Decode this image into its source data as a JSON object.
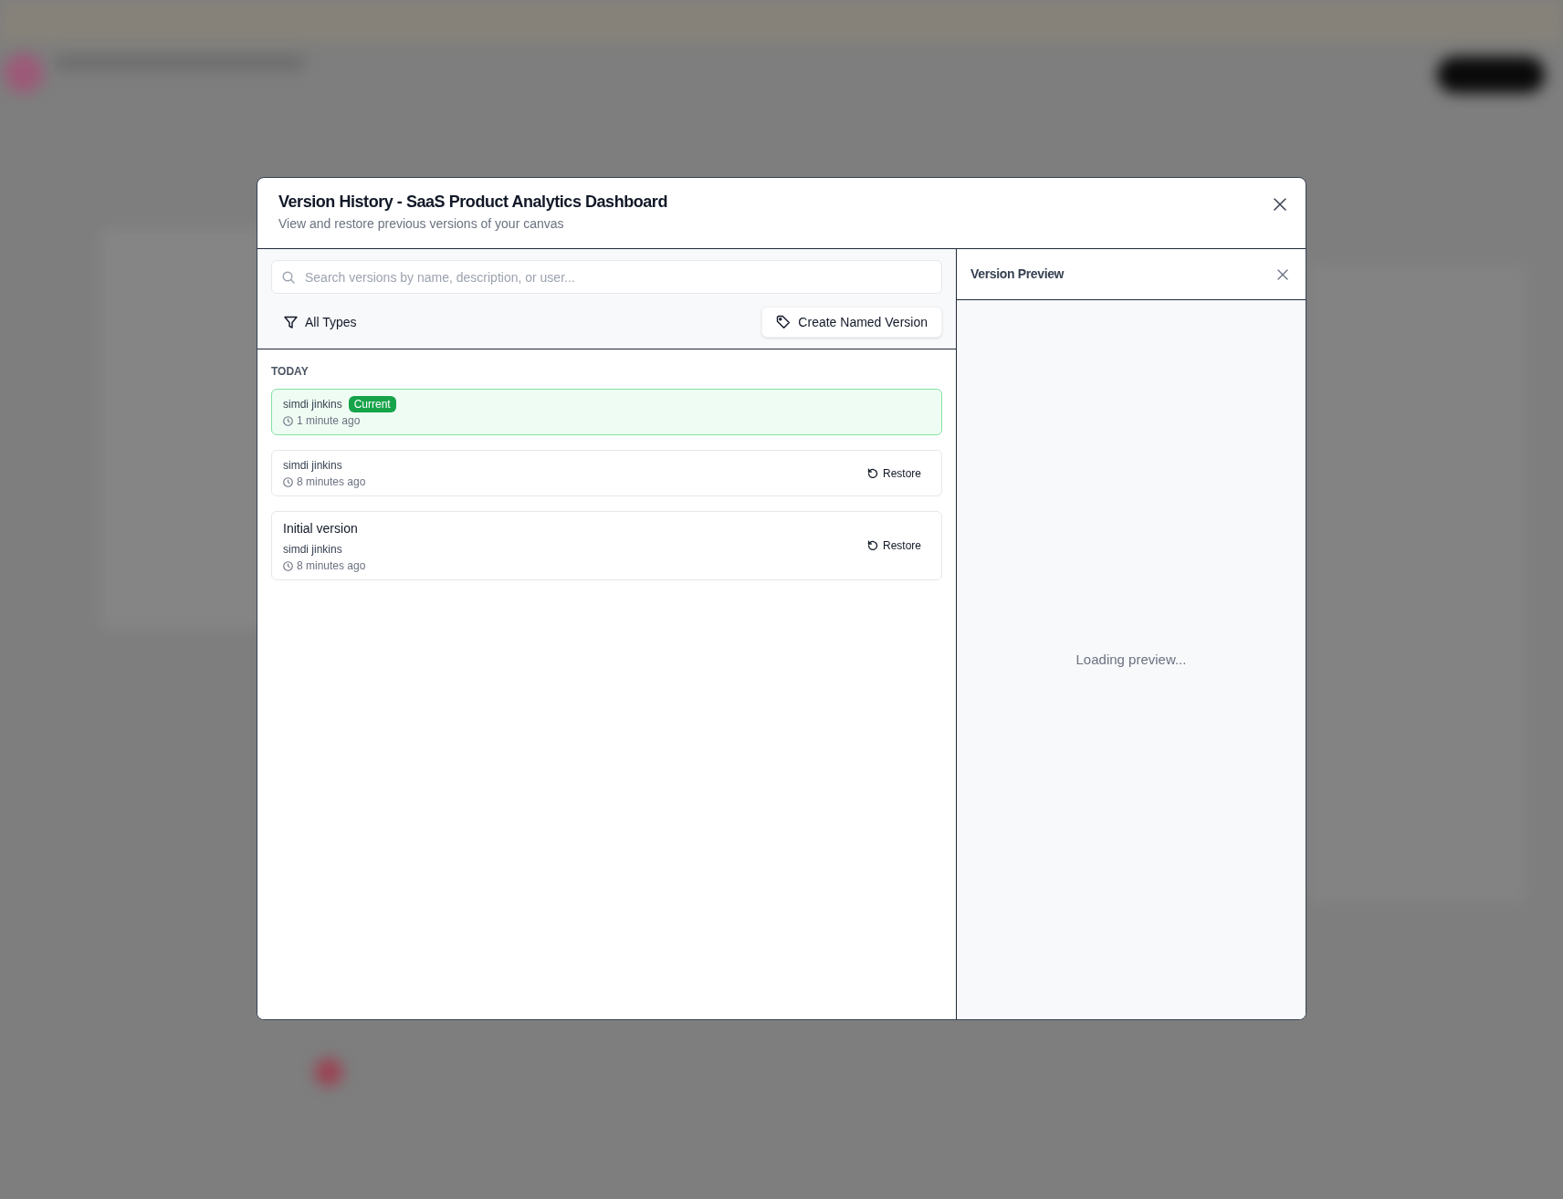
{
  "dialog": {
    "title": "Version History - SaaS Product Analytics Dashboard",
    "subtitle": "View and restore previous versions of your canvas"
  },
  "search": {
    "placeholder": "Search versions by name, description, or user..."
  },
  "filter": {
    "label": "All Types"
  },
  "create_button": {
    "label": "Create Named Version"
  },
  "groups": [
    {
      "heading": "TODAY",
      "versions": [
        {
          "author": "simdi jinkins",
          "badge": "Current",
          "time": "1 minute ago",
          "current": true
        },
        {
          "author": "simdi jinkins",
          "time": "8 minutes ago",
          "action": "Restore",
          "current": false
        },
        {
          "title": "Initial version",
          "author": "simdi jinkins",
          "time": "8 minutes ago",
          "action": "Restore",
          "current": false
        }
      ]
    }
  ],
  "preview": {
    "title": "Version Preview",
    "status": "Loading preview..."
  }
}
